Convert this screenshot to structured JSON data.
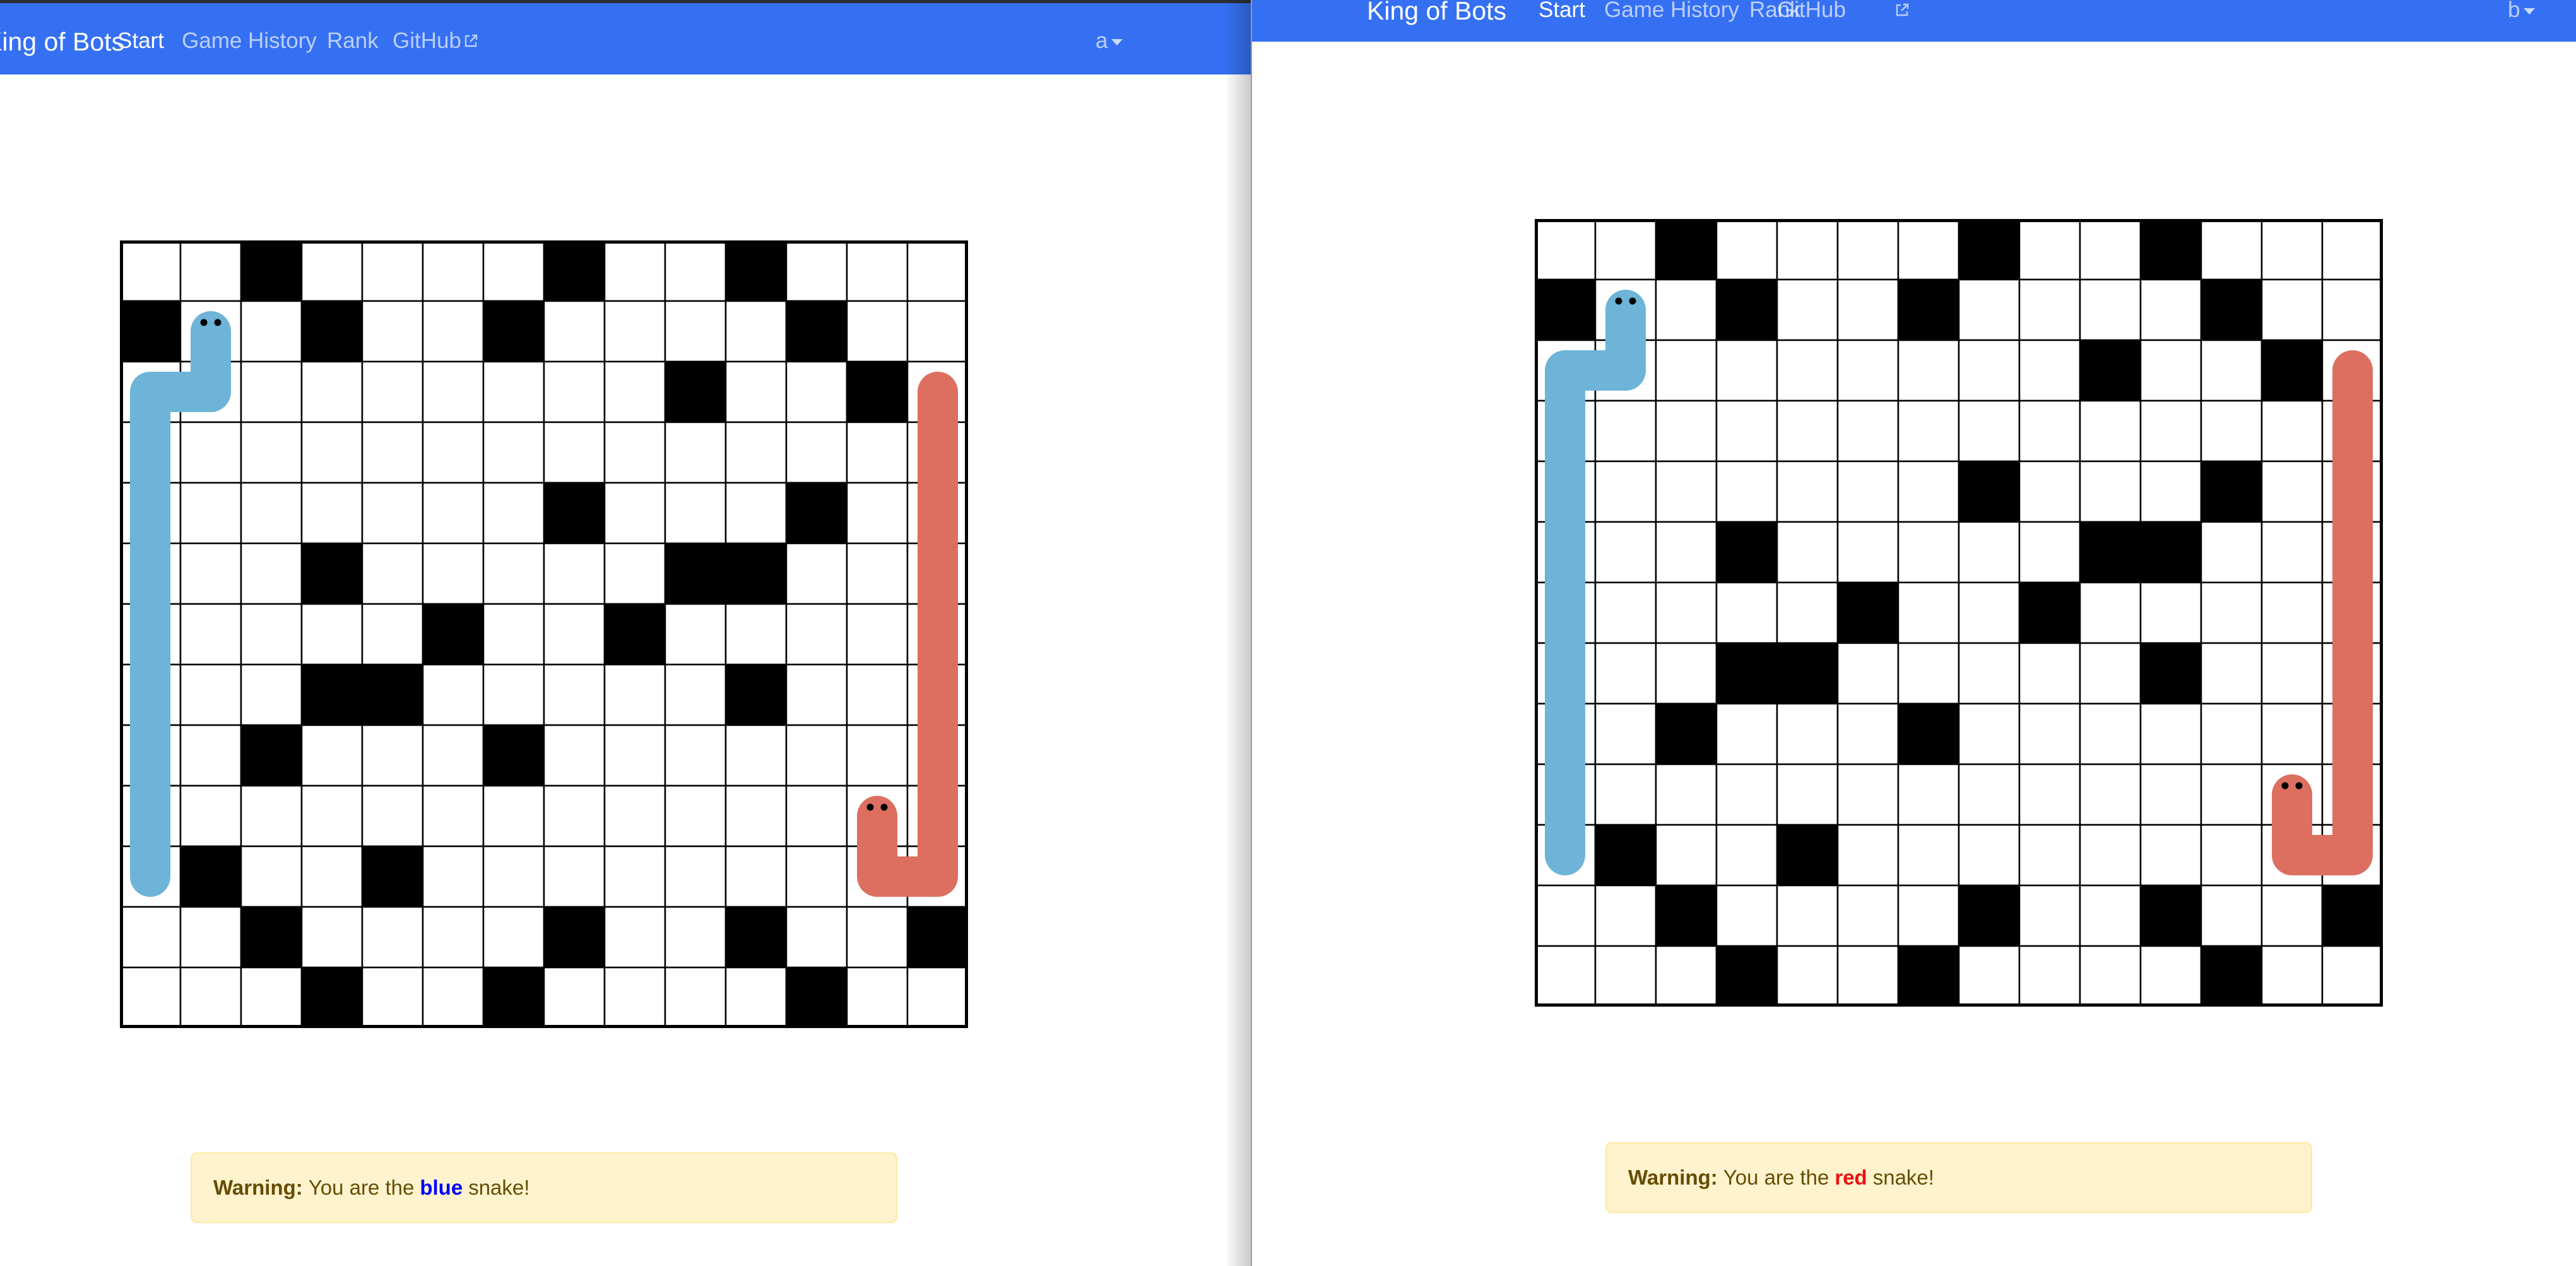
{
  "left": {
    "nav": {
      "brand": "King of Bots",
      "links": [
        "Start",
        "Game History",
        "Rank",
        "GitHub"
      ],
      "active": "Start",
      "user": "a"
    },
    "alert": {
      "label": "Warning:",
      "before": "You are the",
      "color_word": "blue",
      "after": "snake!",
      "color_hex": "#0000ff"
    }
  },
  "right": {
    "nav": {
      "brand": "King of Bots",
      "links": [
        "Start",
        "Game History",
        "Rank",
        "GitHub"
      ],
      "active": "Start",
      "user": "b"
    },
    "alert": {
      "label": "Warning:",
      "before": "You are the",
      "color_word": "red",
      "after": "snake!",
      "color_hex": "#ee1111"
    }
  },
  "colors": {
    "navbar": "#3570f3",
    "blue_snake": "#6db4d8",
    "red_snake": "#dc6f5f",
    "wall": "#000000",
    "alert_bg": "#fff3cd"
  },
  "boards": {
    "rows": 13,
    "cols": 14,
    "left_walls": [
      [
        0,
        2
      ],
      [
        0,
        7
      ],
      [
        0,
        10
      ],
      [
        1,
        0
      ],
      [
        1,
        3
      ],
      [
        1,
        6
      ],
      [
        1,
        11
      ],
      [
        2,
        9
      ],
      [
        2,
        12
      ],
      [
        4,
        7
      ],
      [
        4,
        11
      ],
      [
        5,
        3
      ],
      [
        5,
        9
      ],
      [
        5,
        10
      ],
      [
        6,
        5
      ],
      [
        6,
        8
      ],
      [
        7,
        3
      ],
      [
        7,
        4
      ],
      [
        7,
        10
      ],
      [
        8,
        2
      ],
      [
        8,
        6
      ],
      [
        10,
        1
      ],
      [
        10,
        4
      ],
      [
        11,
        2
      ],
      [
        11,
        7
      ],
      [
        11,
        10
      ],
      [
        11,
        13
      ],
      [
        12,
        3
      ],
      [
        12,
        6
      ],
      [
        12,
        11
      ]
    ],
    "right_walls": [
      [
        0,
        2
      ],
      [
        0,
        7
      ],
      [
        0,
        10
      ],
      [
        1,
        0
      ],
      [
        1,
        3
      ],
      [
        1,
        6
      ],
      [
        1,
        11
      ],
      [
        2,
        9
      ],
      [
        2,
        12
      ],
      [
        4,
        7
      ],
      [
        4,
        11
      ],
      [
        5,
        3
      ],
      [
        5,
        9
      ],
      [
        5,
        10
      ],
      [
        6,
        5
      ],
      [
        6,
        8
      ],
      [
        7,
        3
      ],
      [
        7,
        4
      ],
      [
        7,
        10
      ],
      [
        8,
        2
      ],
      [
        8,
        6
      ],
      [
        10,
        1
      ],
      [
        10,
        4
      ],
      [
        11,
        2
      ],
      [
        11,
        7
      ],
      [
        11,
        10
      ],
      [
        11,
        13
      ],
      [
        12,
        3
      ],
      [
        12,
        6
      ],
      [
        12,
        11
      ]
    ],
    "blue_snake": [
      [
        1,
        1
      ],
      [
        2,
        1
      ],
      [
        2,
        0
      ],
      [
        3,
        0
      ],
      [
        4,
        0
      ],
      [
        5,
        0
      ],
      [
        6,
        0
      ],
      [
        7,
        0
      ],
      [
        8,
        0
      ],
      [
        9,
        0
      ],
      [
        10,
        0
      ]
    ],
    "red_snake": [
      [
        9,
        12
      ],
      [
        10,
        12
      ],
      [
        10,
        13
      ],
      [
        9,
        13
      ],
      [
        8,
        13
      ],
      [
        7,
        13
      ],
      [
        6,
        13
      ],
      [
        5,
        13
      ],
      [
        4,
        13
      ],
      [
        3,
        13
      ],
      [
        2,
        13
      ]
    ]
  }
}
